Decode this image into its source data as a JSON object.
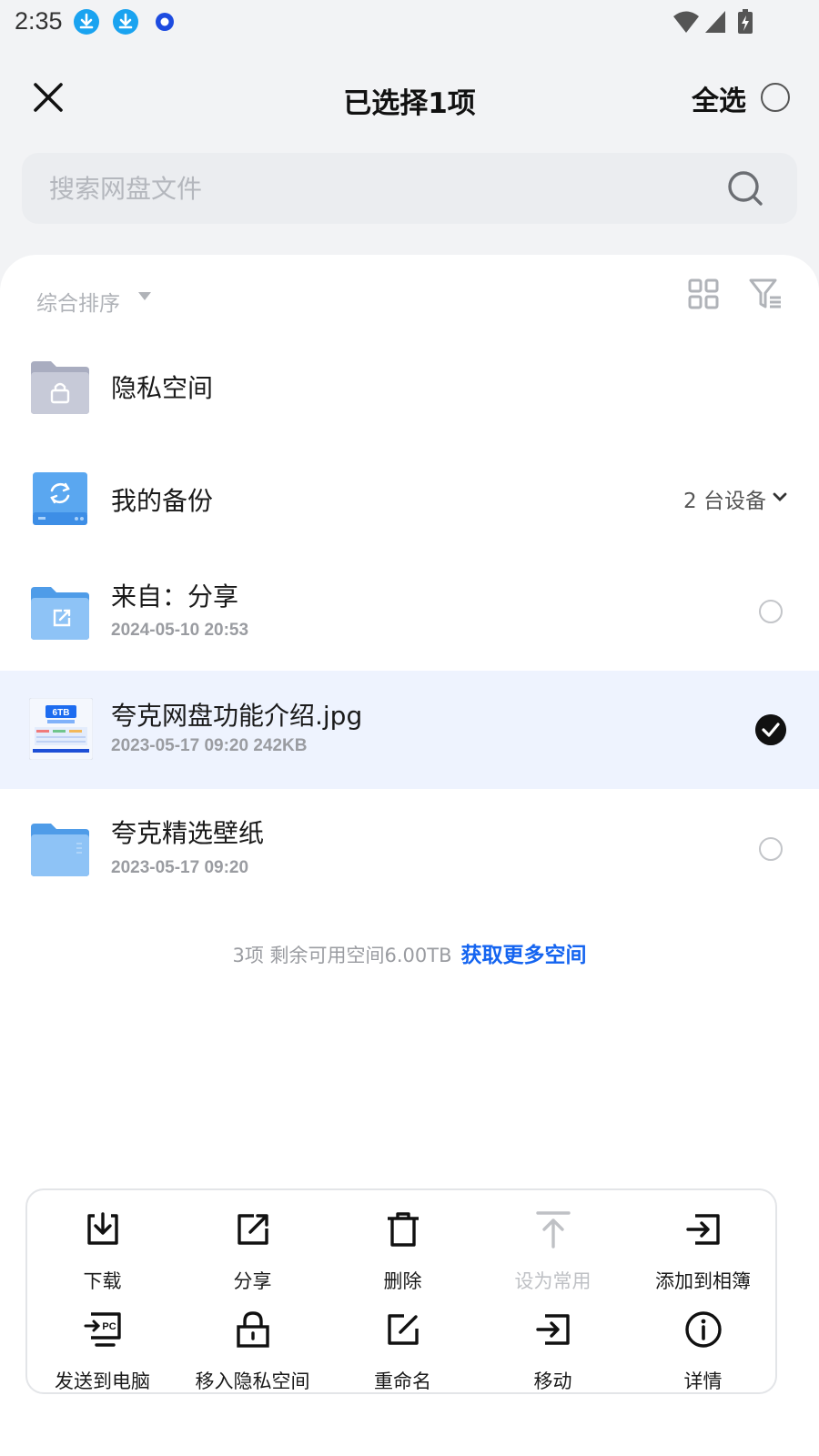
{
  "status_bar": {
    "time": "2:35"
  },
  "header": {
    "title": "已选择1项",
    "select_all": "全选"
  },
  "search": {
    "placeholder": "搜索网盘文件"
  },
  "toolbar": {
    "sort_label": "综合排序"
  },
  "files": [
    {
      "name": "隐私空间"
    },
    {
      "name": "我的备份",
      "devices": "2 台设备"
    },
    {
      "name": "来自：分享",
      "meta": "2024-05-10 20:53"
    },
    {
      "name": "夸克网盘功能介绍.jpg",
      "meta": "2023-05-17 09:20  242KB",
      "selected": true
    },
    {
      "name": "夸克精选壁纸",
      "meta": "2023-05-17 09:20"
    }
  ],
  "summary": {
    "text": "3项 剩余可用空间6.00TB",
    "link": "获取更多空间"
  },
  "actions": [
    {
      "label": "下载",
      "icon": "download-icon"
    },
    {
      "label": "分享",
      "icon": "share-icon"
    },
    {
      "label": "删除",
      "icon": "trash-icon"
    },
    {
      "label": "设为常用",
      "icon": "pin-top-icon",
      "disabled": true
    },
    {
      "label": "添加到相簿",
      "icon": "add-to-album-icon"
    },
    {
      "label": "发送到电脑",
      "icon": "send-to-pc-icon"
    },
    {
      "label": "移入隐私空间",
      "icon": "lock-icon"
    },
    {
      "label": "重命名",
      "icon": "rename-icon"
    },
    {
      "label": "移动",
      "icon": "move-icon"
    },
    {
      "label": "详情",
      "icon": "info-icon"
    }
  ],
  "colors": {
    "accent": "#1464f0",
    "selected_row": "#eef3fe",
    "folder_blue": "#5aa7f0"
  }
}
